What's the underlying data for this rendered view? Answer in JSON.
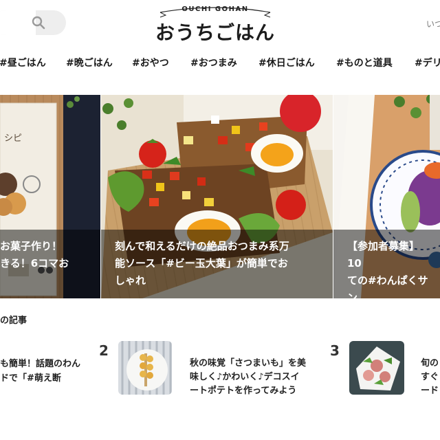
{
  "header": {
    "logo_en": "OUCHI GOHAN",
    "logo_jp": "おうちごはん",
    "right_text": "いつ"
  },
  "search": {
    "placeholder": ""
  },
  "nav": {
    "items": [
      "#昼ごはん",
      "#晩ごはん",
      "#おやつ",
      "#おつまみ",
      "#休日ごはん",
      "#ものと道具",
      "#デリ"
    ]
  },
  "slider": {
    "slides": [
      {
        "title_line1": "お菓子作り！",
        "title_line2": "きる！6コマお",
        "book_text": "シピ"
      },
      {
        "title_line1": "刻んで和えるだけの絶品おつまみ系万",
        "title_line2": "能ソース「#ビー玉大葉」が簡単でお",
        "title_line3": "しゃれ"
      },
      {
        "title_line1": "【参加者募集】10",
        "title_line2": "ての#わんぱくサン"
      }
    ]
  },
  "ranking": {
    "title": "の記事",
    "items": [
      {
        "rank": "",
        "line1": "も簡単！話題のわん",
        "line2": "ドで「#萌え断"
      },
      {
        "rank": "2",
        "line1": "秋の味覚「さつまいも」を美",
        "line2": "味しく♪かわいく♪デコスイ",
        "line3": "ートポテトを作ってみよう"
      },
      {
        "rank": "3",
        "line1": "旬の",
        "line2": "すぐ",
        "line3": "ード"
      }
    ]
  }
}
